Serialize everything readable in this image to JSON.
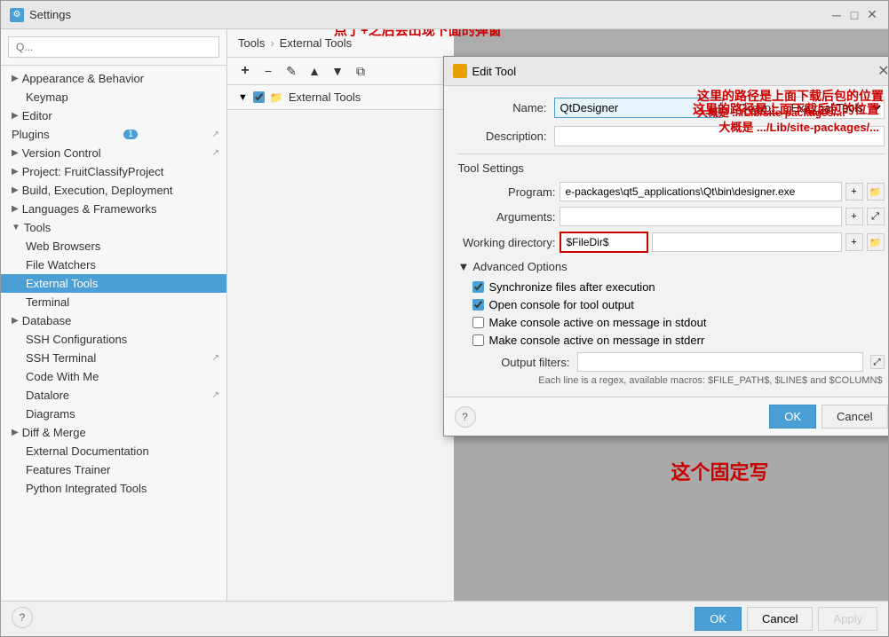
{
  "window": {
    "title": "Settings",
    "icon": "⚙"
  },
  "sidebar": {
    "search_placeholder": "Q...",
    "items": [
      {
        "id": "appearance",
        "label": "Appearance & Behavior",
        "expanded": false,
        "level": 0,
        "arrow": "▶"
      },
      {
        "id": "keymap",
        "label": "Keymap",
        "level": 1
      },
      {
        "id": "editor",
        "label": "Editor",
        "expanded": false,
        "level": 0,
        "arrow": "▶"
      },
      {
        "id": "plugins",
        "label": "Plugins",
        "level": 0,
        "badge": "1",
        "has_icon": true
      },
      {
        "id": "version-control",
        "label": "Version Control",
        "level": 0,
        "arrow": "▶",
        "has_right_icon": true
      },
      {
        "id": "project",
        "label": "Project: FruitClassifyProject",
        "level": 0,
        "arrow": "▶"
      },
      {
        "id": "build",
        "label": "Build, Execution, Deployment",
        "level": 0,
        "arrow": "▶"
      },
      {
        "id": "languages",
        "label": "Languages & Frameworks",
        "level": 0,
        "arrow": "▶"
      },
      {
        "id": "tools",
        "label": "Tools",
        "level": 0,
        "arrow": "▼",
        "expanded": true
      },
      {
        "id": "web-browsers",
        "label": "Web Browsers",
        "level": 1
      },
      {
        "id": "file-watchers",
        "label": "File Watchers",
        "level": 1
      },
      {
        "id": "external-tools",
        "label": "External Tools",
        "level": 1,
        "selected": true
      },
      {
        "id": "terminal",
        "label": "Terminal",
        "level": 1
      },
      {
        "id": "database",
        "label": "Database",
        "level": 0,
        "arrow": "▶"
      },
      {
        "id": "ssh-config",
        "label": "SSH Configurations",
        "level": 1
      },
      {
        "id": "ssh-terminal",
        "label": "SSH Terminal",
        "level": 1,
        "has_right_icon": true
      },
      {
        "id": "code-with-me",
        "label": "Code With Me",
        "level": 1
      },
      {
        "id": "datalore",
        "label": "Datalore",
        "level": 1,
        "has_right_icon": true
      },
      {
        "id": "diagrams",
        "label": "Diagrams",
        "level": 1
      },
      {
        "id": "diff-merge",
        "label": "Diff & Merge",
        "level": 0,
        "arrow": "▶"
      },
      {
        "id": "external-doc",
        "label": "External Documentation",
        "level": 1
      },
      {
        "id": "features-trainer",
        "label": "Features Trainer",
        "level": 1
      },
      {
        "id": "python-tools",
        "label": "Python Integrated Tools",
        "level": 1
      }
    ]
  },
  "breadcrumb": {
    "items": [
      "Tools",
      "External Tools"
    ]
  },
  "toolbar": {
    "add_label": "+",
    "edit_label": "✎",
    "up_label": "▲",
    "down_label": "▼",
    "copy_label": "⧉"
  },
  "tree": {
    "label": "External Tools",
    "expanded": true,
    "arrow": "▼"
  },
  "modal": {
    "title": "Edit Tool",
    "name_label": "Name:",
    "name_value": "QtDesigner",
    "group_label": "Group:",
    "group_value": "External Tools",
    "description_label": "Description:",
    "description_value": "",
    "tool_settings_label": "Tool Settings",
    "program_label": "Program:",
    "program_value": "e-packages\\qt5_applications\\Qt\\bin\\designer.exe",
    "arguments_label": "Arguments:",
    "arguments_value": "",
    "working_dir_label": "Working directory:",
    "working_dir_value": "$FileDir$",
    "advanced_label": "Advanced Options",
    "sync_files_label": "Synchronize files after execution",
    "open_console_label": "Open console for tool output",
    "make_active_stdout_label": "Make console active on message in stdout",
    "make_active_stderr_label": "Make console active on message in stderr",
    "output_filters_label": "Output filters:",
    "output_filters_value": "",
    "macro_hint": "Each line is a regex, available macros: $FILE_PATH$, $LINE$ and $COLUMN$",
    "ok_label": "OK",
    "cancel_label": "Cancel"
  },
  "annotations": {
    "top_text": "点了+之后会出现下面的弹窗",
    "right_text": "这里的路径是上面下载后包的位置",
    "right_subtext": "大概是 .../Lib/site-packages/...",
    "bottom_text": "这个固定写"
  },
  "bottom_bar": {
    "help_label": "?",
    "ok_label": "OK",
    "cancel_label": "Cancel",
    "apply_label": "Apply"
  }
}
